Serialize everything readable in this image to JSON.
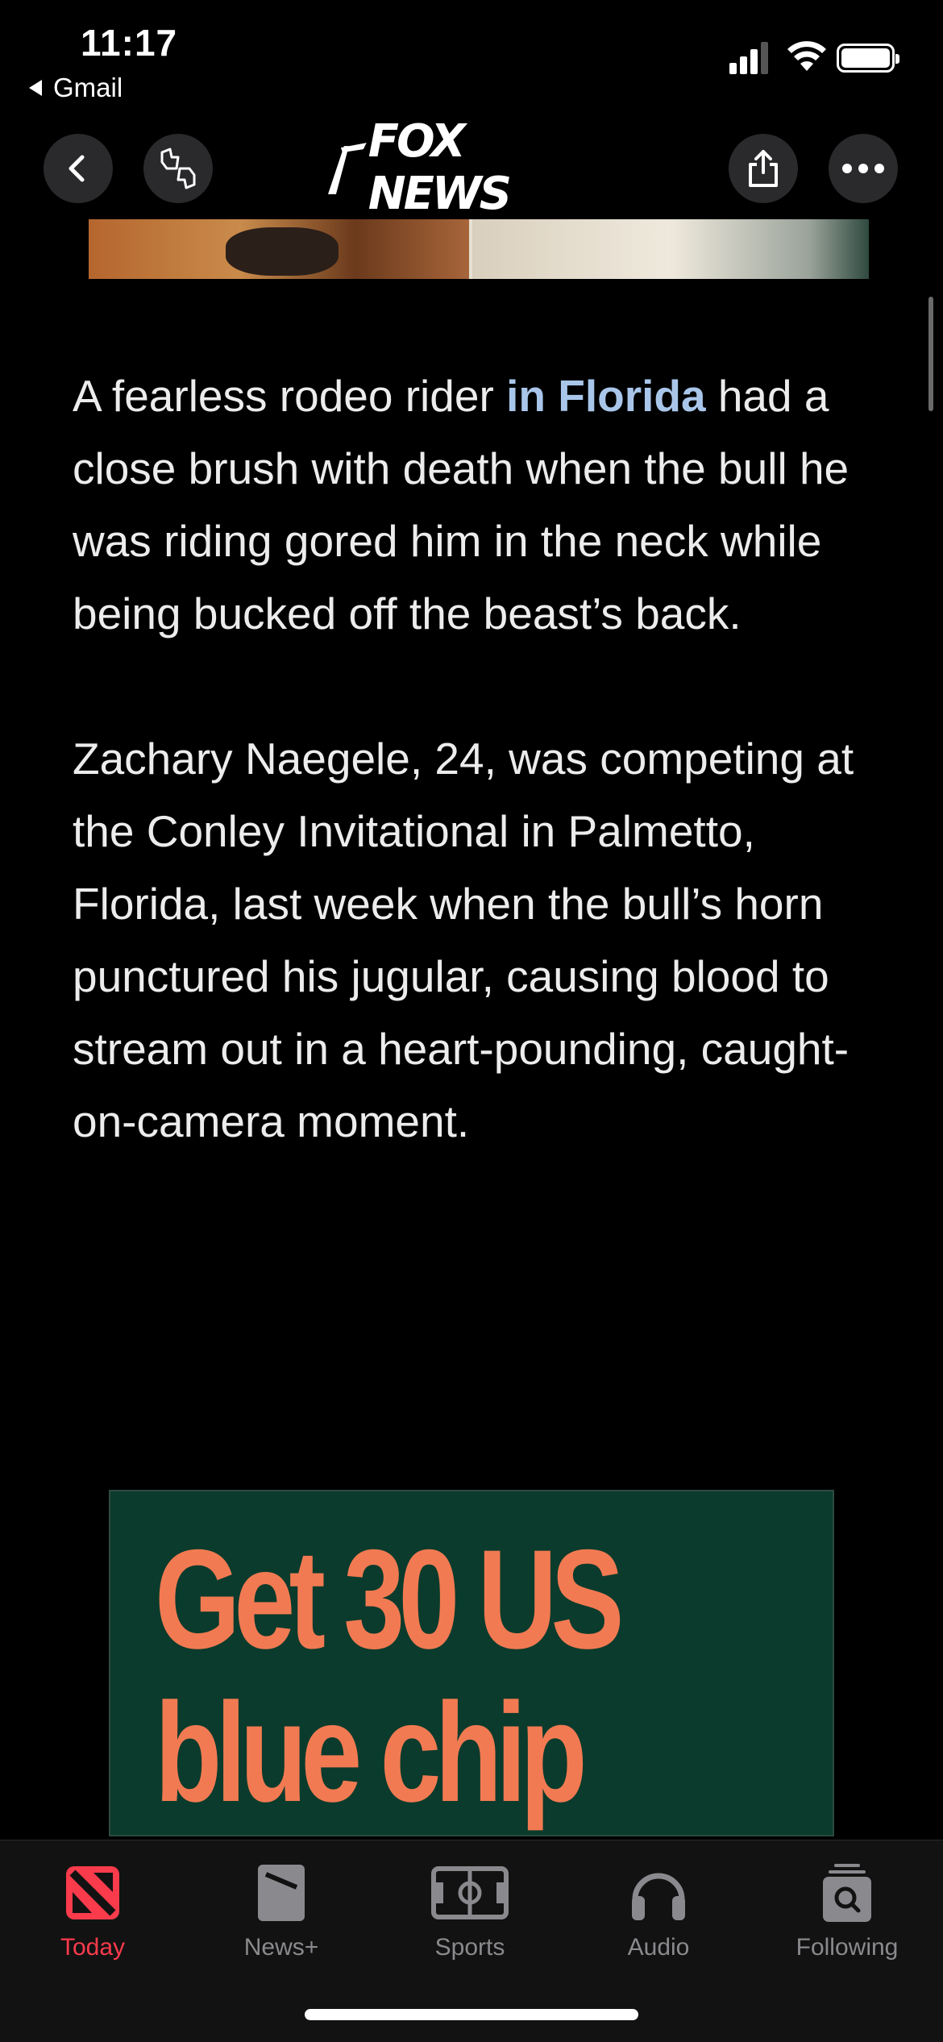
{
  "status_bar": {
    "time": "11:17",
    "back_app": "Gmail"
  },
  "nav": {
    "logo": "FOX NEWS"
  },
  "article": {
    "p1_before": "A fearless rodeo rider ",
    "p1_link": "in Florida",
    "p1_after": " had a close brush with death when the bull he was riding gored him in the neck while being bucked off the beast’s back.",
    "p2": "Zachary Naegele, 24, was competing at the Conley Invitational in Palmetto, Florida, last week when the bull’s horn punctured his jugular, causing blood to stream out in a heart-pounding, caught-on-camera moment."
  },
  "ad": {
    "line1": "Get 30 US",
    "line2": "blue chip"
  },
  "tabs": [
    {
      "label": "Today",
      "active": true
    },
    {
      "label": "News+",
      "active": false
    },
    {
      "label": "Sports",
      "active": false
    },
    {
      "label": "Audio",
      "active": false
    },
    {
      "label": "Following",
      "active": false
    }
  ],
  "colors": {
    "accent": "#fa3b4c",
    "link": "#a9c6ea",
    "ad_bg": "#0b3b2c",
    "ad_text": "#f27a52"
  }
}
